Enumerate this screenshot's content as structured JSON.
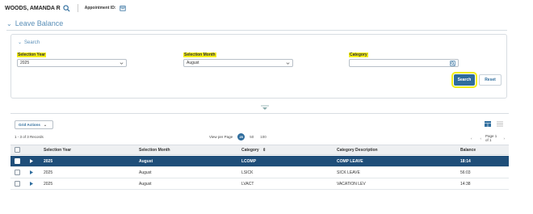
{
  "header": {
    "employee_name": "WOODS, AMANDA R",
    "appointment_label": "Appointment ID:"
  },
  "panel": {
    "title": "Leave Balance"
  },
  "search": {
    "heading": "Search",
    "fields": {
      "year_label": "Selection Year",
      "year_value": "2025",
      "month_label": "Selection Month",
      "month_value": "August",
      "category_label": "Category",
      "category_value": ""
    },
    "search_button": "Search",
    "reset_button": "Reset"
  },
  "grid": {
    "actions_label": "Grid Actions",
    "records_text": "1 - 3 of 3 Records",
    "view_per_page_label": "View per Page",
    "per_page_options": [
      "25",
      "50",
      "100"
    ],
    "per_page_selected": "25",
    "page_text": "Page 1 of 1",
    "columns": [
      "Selection Year",
      "Selection Month",
      "Category",
      "Category Description",
      "Balance"
    ],
    "sort_icon": "sort-icon",
    "rows": [
      {
        "year": "2025",
        "month": "August",
        "category": "LCOMP",
        "description": "COMP LEAVE",
        "balance": "18:14",
        "selected": true
      },
      {
        "year": "2025",
        "month": "August",
        "category": "LSICK",
        "description": "SICK LEAVE",
        "balance": "56:03",
        "selected": false
      },
      {
        "year": "2025",
        "month": "August",
        "category": "LVACT",
        "description": "VACATION LEV",
        "balance": "14:38",
        "selected": false
      }
    ]
  },
  "colors": {
    "accent": "#2f6d9d",
    "selected_row": "#1f4e79",
    "highlight": "#f4ee17",
    "title_blue": "#5a8fb8"
  }
}
